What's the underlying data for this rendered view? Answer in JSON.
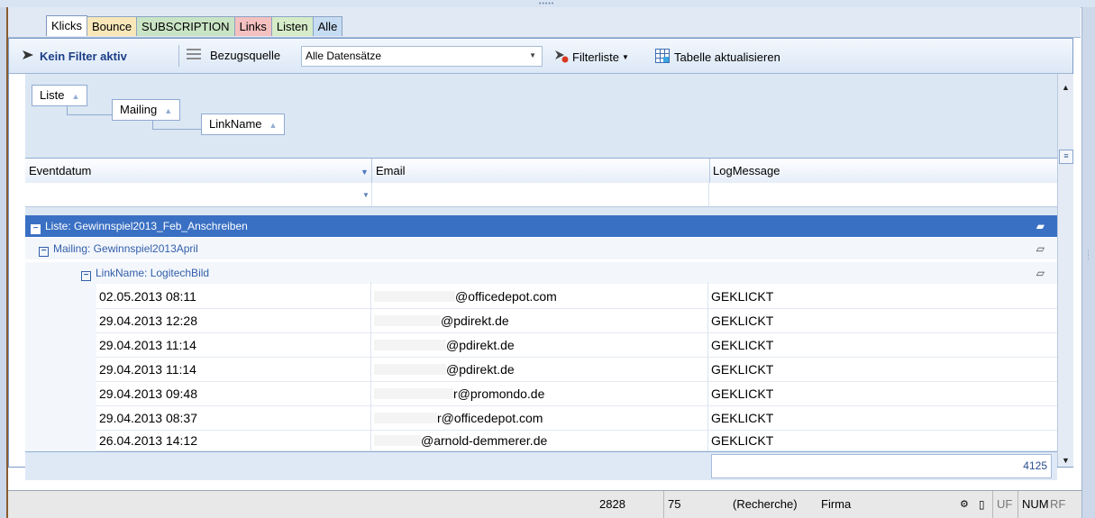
{
  "tabs": [
    {
      "label": "Klicks",
      "active": true,
      "color": "#ffffff"
    },
    {
      "label": "Bounce",
      "color": "#f7e7b9"
    },
    {
      "label": "SUBSCRIPTION",
      "color": "#c9e4c5"
    },
    {
      "label": "Links",
      "color": "#f4c0c0"
    },
    {
      "label": "Listen",
      "color": "#d6ecc9"
    },
    {
      "label": "Alle",
      "color": "#c6dcf2"
    }
  ],
  "toolbar": {
    "filter_status": "Kein Filter aktiv",
    "source_label": "Bezugsquelle",
    "source_value": "Alle Datensätze",
    "filterlist_label": "Filterliste",
    "refresh_label": "Tabelle aktualisieren"
  },
  "grouping": {
    "levels": [
      "Liste",
      "Mailing",
      "LinkName"
    ]
  },
  "columns": [
    "Eventdatum",
    "Email",
    "LogMessage"
  ],
  "groups": {
    "liste": "Liste: Gewinnspiel2013_Feb_Anschreiben",
    "mailing": "Mailing: Gewinnspiel2013April",
    "linkname": "LinkName: LogitechBild"
  },
  "rows": [
    {
      "date": "02.05.2013 08:11",
      "email": "@officedepot.com",
      "log": "GEKLICKT"
    },
    {
      "date": "29.04.2013 12:28",
      "email": "@pdirekt.de",
      "log": "GEKLICKT"
    },
    {
      "date": "29.04.2013 11:14",
      "email": "@pdirekt.de",
      "log": "GEKLICKT"
    },
    {
      "date": "29.04.2013 11:14",
      "email": "@pdirekt.de",
      "log": "GEKLICKT"
    },
    {
      "date": "29.04.2013 09:48",
      "email": "r@promondo.de",
      "log": "GEKLICKT"
    },
    {
      "date": "29.04.2013 08:37",
      "email": "r@officedepot.com",
      "log": "GEKLICKT"
    },
    {
      "date": "26.04.2013 14:12",
      "email": "@arnold-demmerer.de",
      "log": "GEKLICKT"
    }
  ],
  "footer": {
    "count": "4125"
  },
  "statusbar": {
    "f1": "2828",
    "f2": "75",
    "f3": "(Recherche)",
    "f4": "Firma",
    "f5": "UF",
    "f6": "NUM",
    "f7": "RF"
  },
  "colors": {
    "accent": "#3a70c3",
    "group_text": "#335ea9",
    "header_bg": "#dce7f4"
  }
}
